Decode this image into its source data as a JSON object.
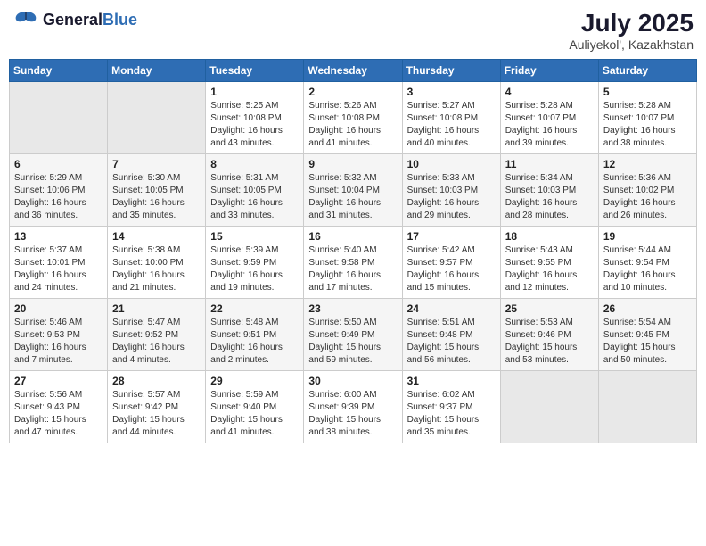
{
  "header": {
    "logo_general": "General",
    "logo_blue": "Blue",
    "month_year": "July 2025",
    "location": "Auliyekol', Kazakhstan"
  },
  "days_of_week": [
    "Sunday",
    "Monday",
    "Tuesday",
    "Wednesday",
    "Thursday",
    "Friday",
    "Saturday"
  ],
  "weeks": [
    [
      {
        "day": "",
        "info": ""
      },
      {
        "day": "",
        "info": ""
      },
      {
        "day": "1",
        "info": "Sunrise: 5:25 AM\nSunset: 10:08 PM\nDaylight: 16 hours\nand 43 minutes."
      },
      {
        "day": "2",
        "info": "Sunrise: 5:26 AM\nSunset: 10:08 PM\nDaylight: 16 hours\nand 41 minutes."
      },
      {
        "day": "3",
        "info": "Sunrise: 5:27 AM\nSunset: 10:08 PM\nDaylight: 16 hours\nand 40 minutes."
      },
      {
        "day": "4",
        "info": "Sunrise: 5:28 AM\nSunset: 10:07 PM\nDaylight: 16 hours\nand 39 minutes."
      },
      {
        "day": "5",
        "info": "Sunrise: 5:28 AM\nSunset: 10:07 PM\nDaylight: 16 hours\nand 38 minutes."
      }
    ],
    [
      {
        "day": "6",
        "info": "Sunrise: 5:29 AM\nSunset: 10:06 PM\nDaylight: 16 hours\nand 36 minutes."
      },
      {
        "day": "7",
        "info": "Sunrise: 5:30 AM\nSunset: 10:05 PM\nDaylight: 16 hours\nand 35 minutes."
      },
      {
        "day": "8",
        "info": "Sunrise: 5:31 AM\nSunset: 10:05 PM\nDaylight: 16 hours\nand 33 minutes."
      },
      {
        "day": "9",
        "info": "Sunrise: 5:32 AM\nSunset: 10:04 PM\nDaylight: 16 hours\nand 31 minutes."
      },
      {
        "day": "10",
        "info": "Sunrise: 5:33 AM\nSunset: 10:03 PM\nDaylight: 16 hours\nand 29 minutes."
      },
      {
        "day": "11",
        "info": "Sunrise: 5:34 AM\nSunset: 10:03 PM\nDaylight: 16 hours\nand 28 minutes."
      },
      {
        "day": "12",
        "info": "Sunrise: 5:36 AM\nSunset: 10:02 PM\nDaylight: 16 hours\nand 26 minutes."
      }
    ],
    [
      {
        "day": "13",
        "info": "Sunrise: 5:37 AM\nSunset: 10:01 PM\nDaylight: 16 hours\nand 24 minutes."
      },
      {
        "day": "14",
        "info": "Sunrise: 5:38 AM\nSunset: 10:00 PM\nDaylight: 16 hours\nand 21 minutes."
      },
      {
        "day": "15",
        "info": "Sunrise: 5:39 AM\nSunset: 9:59 PM\nDaylight: 16 hours\nand 19 minutes."
      },
      {
        "day": "16",
        "info": "Sunrise: 5:40 AM\nSunset: 9:58 PM\nDaylight: 16 hours\nand 17 minutes."
      },
      {
        "day": "17",
        "info": "Sunrise: 5:42 AM\nSunset: 9:57 PM\nDaylight: 16 hours\nand 15 minutes."
      },
      {
        "day": "18",
        "info": "Sunrise: 5:43 AM\nSunset: 9:55 PM\nDaylight: 16 hours\nand 12 minutes."
      },
      {
        "day": "19",
        "info": "Sunrise: 5:44 AM\nSunset: 9:54 PM\nDaylight: 16 hours\nand 10 minutes."
      }
    ],
    [
      {
        "day": "20",
        "info": "Sunrise: 5:46 AM\nSunset: 9:53 PM\nDaylight: 16 hours\nand 7 minutes."
      },
      {
        "day": "21",
        "info": "Sunrise: 5:47 AM\nSunset: 9:52 PM\nDaylight: 16 hours\nand 4 minutes."
      },
      {
        "day": "22",
        "info": "Sunrise: 5:48 AM\nSunset: 9:51 PM\nDaylight: 16 hours\nand 2 minutes."
      },
      {
        "day": "23",
        "info": "Sunrise: 5:50 AM\nSunset: 9:49 PM\nDaylight: 15 hours\nand 59 minutes."
      },
      {
        "day": "24",
        "info": "Sunrise: 5:51 AM\nSunset: 9:48 PM\nDaylight: 15 hours\nand 56 minutes."
      },
      {
        "day": "25",
        "info": "Sunrise: 5:53 AM\nSunset: 9:46 PM\nDaylight: 15 hours\nand 53 minutes."
      },
      {
        "day": "26",
        "info": "Sunrise: 5:54 AM\nSunset: 9:45 PM\nDaylight: 15 hours\nand 50 minutes."
      }
    ],
    [
      {
        "day": "27",
        "info": "Sunrise: 5:56 AM\nSunset: 9:43 PM\nDaylight: 15 hours\nand 47 minutes."
      },
      {
        "day": "28",
        "info": "Sunrise: 5:57 AM\nSunset: 9:42 PM\nDaylight: 15 hours\nand 44 minutes."
      },
      {
        "day": "29",
        "info": "Sunrise: 5:59 AM\nSunset: 9:40 PM\nDaylight: 15 hours\nand 41 minutes."
      },
      {
        "day": "30",
        "info": "Sunrise: 6:00 AM\nSunset: 9:39 PM\nDaylight: 15 hours\nand 38 minutes."
      },
      {
        "day": "31",
        "info": "Sunrise: 6:02 AM\nSunset: 9:37 PM\nDaylight: 15 hours\nand 35 minutes."
      },
      {
        "day": "",
        "info": ""
      },
      {
        "day": "",
        "info": ""
      }
    ]
  ]
}
